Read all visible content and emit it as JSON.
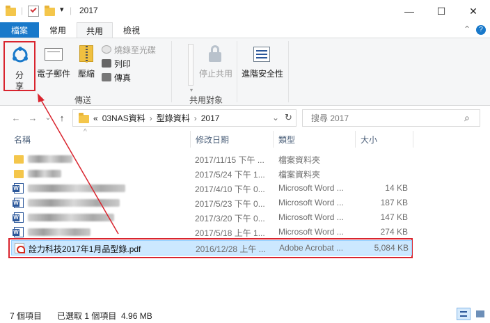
{
  "window": {
    "title": "2017",
    "minimize": "—",
    "maximize": "☐",
    "close": "✕"
  },
  "quick_access": {
    "dropdown": "▾",
    "separator": "|"
  },
  "tabs": {
    "file": "檔案",
    "home": "常用",
    "share": "共用",
    "view": "檢視",
    "collapse": "⌃",
    "help": "?"
  },
  "ribbon": {
    "share_line1": "分",
    "share_line2": "享",
    "email": "電子郵件",
    "zip": "壓縮",
    "burn": "燒錄至光碟",
    "print": "列印",
    "fax": "傳真",
    "group_send": "傳送",
    "stop_sharing": "停止共用",
    "group_share_with": "共用對象",
    "advanced_security": "進階安全性"
  },
  "nav": {
    "back": "←",
    "forward": "→",
    "dropdown": "⌄",
    "up": "↑",
    "breadcrumb_overflow": "«",
    "breadcrumb": [
      "03NAS資料",
      "型錄資料",
      "2017"
    ],
    "breadcrumb_sep": "›",
    "address_dropdown": "⌄",
    "refresh": "↻",
    "search_placeholder": "搜尋 2017",
    "search_icon": "⌕"
  },
  "columns": {
    "name": "名稱",
    "date": "修改日期",
    "type": "類型",
    "size": "大小",
    "sort_arrow": "^"
  },
  "files": [
    {
      "icon": "folder-icon",
      "name": "",
      "date": "2017/11/15 下午 ...",
      "type": "檔案資料夾",
      "size": ""
    },
    {
      "icon": "folder-icon",
      "name": "",
      "date": "2017/5/24 下午 1...",
      "type": "檔案資料夾",
      "size": ""
    },
    {
      "icon": "word-icon",
      "name": "",
      "date": "2017/4/10 下午 0...",
      "type": "Microsoft Word ...",
      "size": "14 KB"
    },
    {
      "icon": "word-icon",
      "name": "",
      "date": "2017/5/23 下午 0...",
      "type": "Microsoft Word ...",
      "size": "187 KB"
    },
    {
      "icon": "word-icon",
      "name": "",
      "date": "2017/3/20 下午 0...",
      "type": "Microsoft Word ...",
      "size": "147 KB"
    },
    {
      "icon": "word-icon",
      "name": "",
      "date": "2017/5/18 上午 1...",
      "type": "Microsoft Word ...",
      "size": "274 KB"
    },
    {
      "icon": "pdf-icon",
      "name": "詮力科技2017年1月品型錄.pdf",
      "date": "2016/12/28 上午 ...",
      "type": "Adobe Acrobat ...",
      "size": "5,084 KB"
    }
  ],
  "status": {
    "count": "7 個項目",
    "selected": "已選取 1 個項目  4.96 MB"
  },
  "colors": {
    "file_tab": "#1979ca",
    "selection": "#cce8ff",
    "annotation": "#d9242e"
  }
}
